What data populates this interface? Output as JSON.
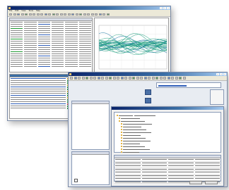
{
  "back_window": {
    "menu": [
      "File",
      "Edit",
      "View",
      "Tools",
      "Help"
    ],
    "chart_data": {
      "type": "line",
      "description": "dense overlaid waveform traces, green/teal",
      "series_color": "#169c7a",
      "grid": true
    },
    "status_colors": {
      "ok": "#1f9a32",
      "warn": "#e0b020",
      "error": "#d03030"
    }
  },
  "front_window": {
    "tree_items_count": 14,
    "table_columns": 4
  },
  "colors": {
    "title_start": "#0a246a",
    "title_end": "#a6caf0",
    "accent": "#2e5db8",
    "waveform": "#169c7a"
  }
}
